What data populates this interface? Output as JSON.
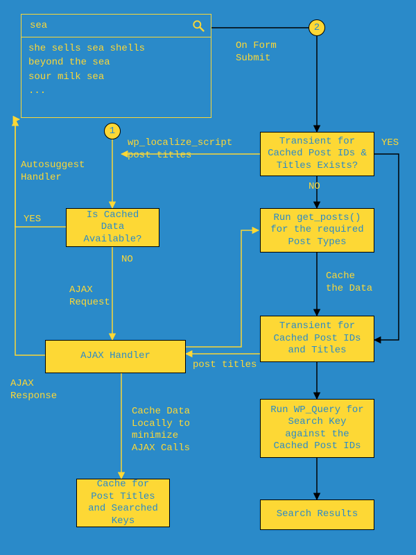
{
  "search": {
    "value": "sea",
    "suggestions": [
      "she sells sea shells",
      "beyond the sea",
      "sour milk sea",
      "..."
    ]
  },
  "markers": {
    "one": "1",
    "two": "2"
  },
  "labels": {
    "autosuggest_handler": "Autosuggest\nHandler",
    "wp_localize": "wp_localize_script\npost titles",
    "on_form_submit": "On Form\nSubmit",
    "yes_left": "YES",
    "yes_right": "YES",
    "no_left": "NO",
    "no_right": "NO",
    "ajax_request": "AJAX\nRequest",
    "ajax_response": "AJAX\nResponse",
    "post_titles": "post titles",
    "cache_the_data": "Cache\nthe Data",
    "cache_locally": "Cache Data\nLocally to\nminimize\nAJAX Calls"
  },
  "boxes": {
    "is_cached": "Is Cached Data\nAvailable?",
    "ajax_handler": "AJAX Handler",
    "cache_for_post": "Cache for Post\nTitles and\nSearched Keys",
    "transient_exists": "Transient for\nCached Post IDs &\nTitles Exists?",
    "run_get_posts": "Run get_posts()\nfor the required\nPost Types",
    "transient_cached": "Transient for\nCached Post IDs\nand Titles",
    "run_wp_query": "Run WP_Query for\nSearch Key against\nthe Cached Post\nIDs",
    "search_results": "Search Results"
  }
}
